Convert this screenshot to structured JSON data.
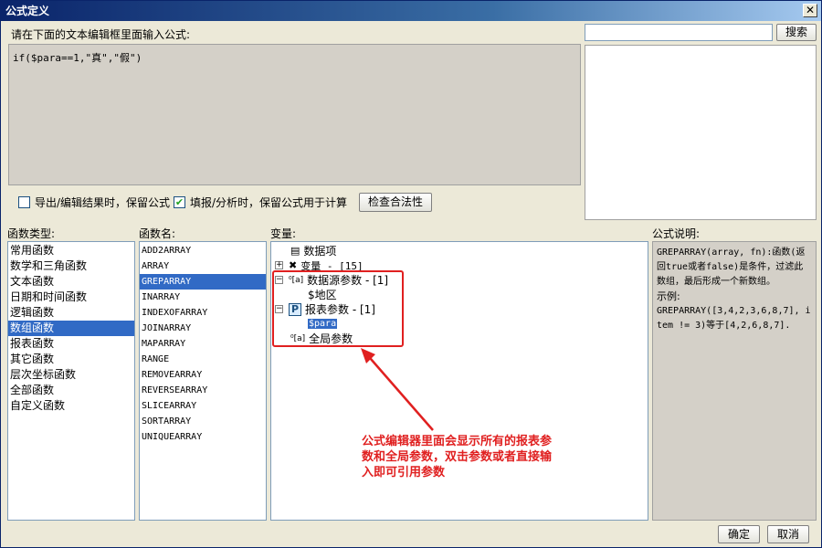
{
  "window": {
    "title": "公式定义",
    "close_glyph": "✕"
  },
  "editor": {
    "prompt": "请在下面的文本编辑框里面输入公式:",
    "formula": "if($para==1,\"真\",\"假\")"
  },
  "search": {
    "placeholder": "",
    "button_label": "搜索"
  },
  "options": {
    "keep_formula_on_export": {
      "label": "导出/编辑结果时，保留公式",
      "checked": false
    },
    "keep_formula_on_fill": {
      "label": "填报/分析时，保留公式用于计算",
      "checked": true
    },
    "validate_button": "检查合法性"
  },
  "sections": {
    "func_type": "函数类型:",
    "func_name": "函数名:",
    "variables": "变量:",
    "description": "公式说明:"
  },
  "func_types": [
    "常用函数",
    "数学和三角函数",
    "文本函数",
    "日期和时间函数",
    "逻辑函数",
    "数组函数",
    "报表函数",
    "其它函数",
    "层次坐标函数",
    "全部函数",
    "自定义函数"
  ],
  "func_types_selected": 5,
  "func_names": [
    "ADD2ARRAY",
    "ARRAY",
    "GREPARRAY",
    "INARRAY",
    "INDEXOFARRAY",
    "JOINARRAY",
    "MAPARRAY",
    "RANGE",
    "REMOVEARRAY",
    "REVERSEARRAY",
    "SLICEARRAY",
    "SORTARRAY",
    "UNIQUEARRAY"
  ],
  "func_names_selected": 2,
  "tree": {
    "data_item": "数据项",
    "variable": "变量 - [15]",
    "datasource_param": "数据源参数 - [1]",
    "region": "$地区",
    "report_param": "报表参数 - [1]",
    "para": "$para",
    "global_param": "全局参数"
  },
  "annotation": "公式编辑器里面会显示所有的报表参数和全局参数，双击参数或者直接输入即可引用参数",
  "description": {
    "line1": "GREPARRAY(array, fn):函数(返回true或者false)是条件，过滤此数组，最后形成一个新数组。",
    "line2": "示例:",
    "line3": "GREPARRAY([3,4,2,3,6,8,7], item != 3)等于[4,2,6,8,7]."
  },
  "buttons": {
    "ok": "确定",
    "cancel": "取消"
  },
  "colors": {
    "selection": "#316ac5",
    "annotation": "#e02020",
    "titlebar": "#0a246a"
  }
}
